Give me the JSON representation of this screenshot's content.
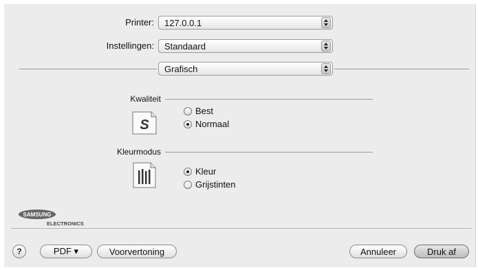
{
  "printer": {
    "label": "Printer:",
    "value": "127.0.0.1"
  },
  "settings": {
    "label": "Instellingen:",
    "value": "Standaard"
  },
  "panel": {
    "value": "Grafisch"
  },
  "quality": {
    "title": "Kwaliteit",
    "options": [
      {
        "label": "Best",
        "selected": false
      },
      {
        "label": "Normaal",
        "selected": true
      }
    ]
  },
  "color_mode": {
    "title": "Kleurmodus",
    "options": [
      {
        "label": "Kleur",
        "selected": true
      },
      {
        "label": "Grijstinten",
        "selected": false
      }
    ]
  },
  "logo": {
    "brand": "SAMSUNG",
    "sub": "ELECTRONICS"
  },
  "footer": {
    "help": "?",
    "pdf": "PDF ▾",
    "preview": "Voorvertoning",
    "cancel": "Annuleer",
    "print": "Druk af"
  }
}
